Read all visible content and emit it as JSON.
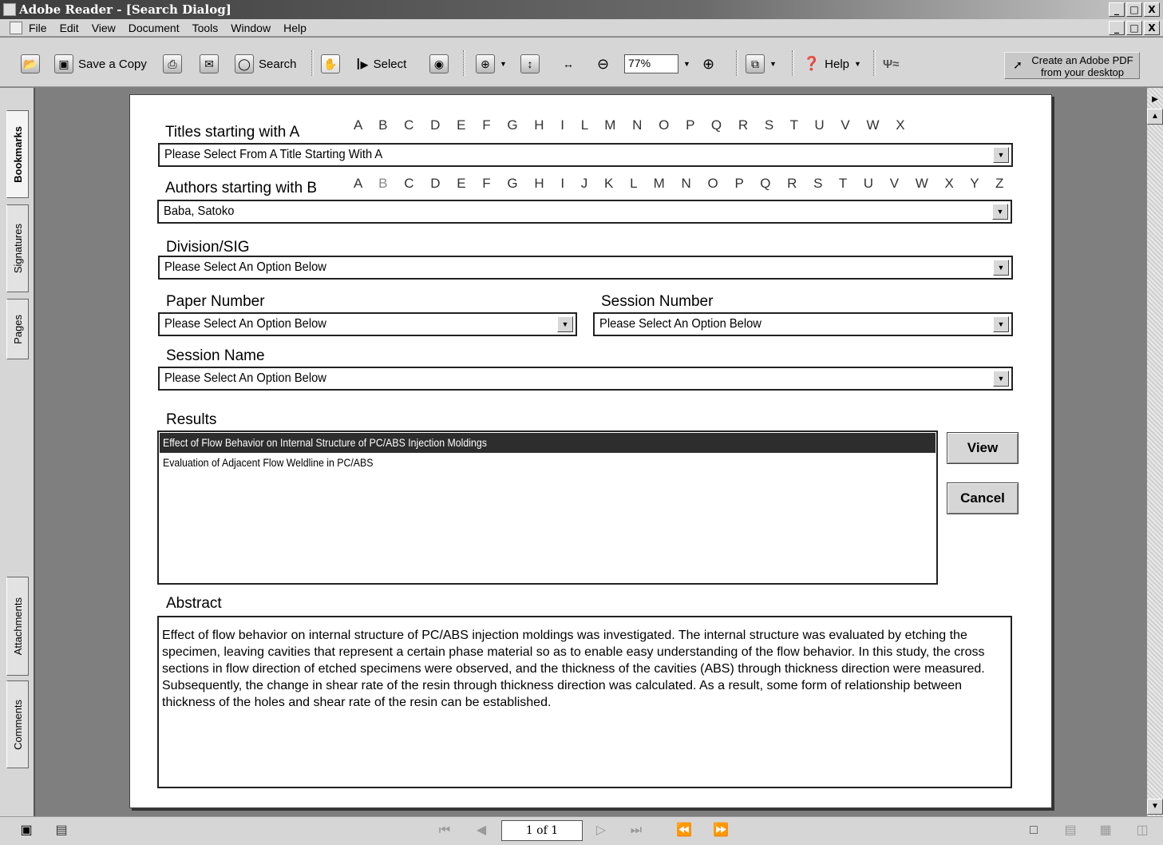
{
  "window": {
    "title": "Adobe Reader - [Search Dialog]",
    "controls": [
      "_",
      "□",
      "X"
    ]
  },
  "menubar": {
    "items": [
      "File",
      "Edit",
      "View",
      "Document",
      "Tools",
      "Window",
      "Help"
    ]
  },
  "toolbar": {
    "save_copy": "Save a Copy",
    "search": "Search",
    "select": "Select",
    "zoom": "77%",
    "help": "Help",
    "create_pdf_line1": "Create an Adobe PDF",
    "create_pdf_line2": "from your desktop"
  },
  "nav_tabs": [
    "Bookmarks",
    "Signatures",
    "Pages",
    "Attachments",
    "Comments"
  ],
  "form": {
    "titles_label": "Titles starting with A",
    "titles_letters": "A B C D E F G H I L M N O P Q R S T U V W X",
    "titles_value": "Please Select From A Title Starting With A",
    "authors_label": "Authors starting with B",
    "authors_letter_a": "A",
    "authors_letter_b": "B",
    "authors_letters_rest": "C D E F G H I J K L M N O P Q R S T U V W X Y Z",
    "authors_value": "Baba, Satoko",
    "division_label": "Division/SIG",
    "division_value": "Please Select An Option Below",
    "paper_label": "Paper Number",
    "paper_value": "Please Select An Option Below",
    "session_number_label": "Session Number",
    "session_number_value": "Please Select An Option Below",
    "session_name_label": "Session Name",
    "session_name_value": "Please Select An Option Below",
    "results_label": "Results",
    "results": [
      "Effect of Flow Behavior on Internal Structure of PC/ABS Injection Moldings",
      "Evaluation of Adjacent Flow Weldline in PC/ABS"
    ],
    "view_button": "View",
    "cancel_button": "Cancel",
    "abstract_label": "Abstract",
    "abstract_text": "Effect of flow behavior on internal structure of PC/ABS injection moldings was investigated. The internal structure was evaluated by etching the specimen, leaving cavities that represent a certain phase material so as to enable easy understanding of the flow behavior. In this study, the cross sections in flow direction of etched specimens were observed, and the thickness of the cavities (ABS) through thickness direction were measured. Subsequently, the change in shear rate of the resin through thickness direction was calculated. As a result, some form of relationship between thickness of the holes and shear rate of the resin can be established."
  },
  "status": {
    "page_indicator": "1 of 1"
  }
}
